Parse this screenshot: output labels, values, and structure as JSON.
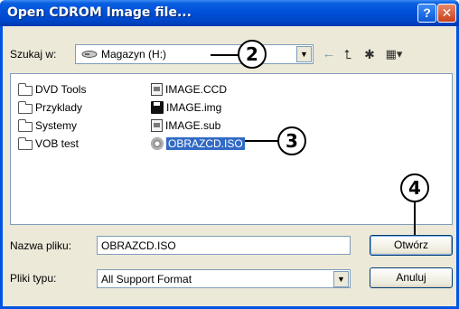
{
  "window": {
    "title": "Open CDROM Image file...",
    "help_label": "?",
    "close_label": "✕"
  },
  "toolbar": {
    "look_in_label": "Szukaj w:",
    "look_in_value": "Magazyn (H:)",
    "dropdown_glyph": "▼",
    "back_glyph": "←",
    "up_glyph": "⮤",
    "new_folder_glyph": "✱",
    "views_glyph": "▦▾",
    "icons": [
      "drive-icon",
      "back-icon",
      "up-folder-icon",
      "new-folder-icon",
      "views-icon"
    ]
  },
  "file_list": {
    "folders": [
      {
        "name": "DVD Tools",
        "icon": "folder-icon"
      },
      {
        "name": "Przyklady",
        "icon": "folder-icon"
      },
      {
        "name": "Systemy",
        "icon": "folder-icon"
      },
      {
        "name": "VOB test",
        "icon": "folder-icon"
      }
    ],
    "files": [
      {
        "name": "IMAGE.CCD",
        "icon": "file-icon"
      },
      {
        "name": "IMAGE.img",
        "icon": "floppy-icon"
      },
      {
        "name": "IMAGE.sub",
        "icon": "file-icon"
      },
      {
        "name": "OBRAZCD.ISO",
        "icon": "cd-icon",
        "selected": true
      }
    ]
  },
  "form": {
    "filename_label": "Nazwa pliku:",
    "filename_value": "OBRAZCD.ISO",
    "filetype_label": "Pliki typu:",
    "filetype_value": "All Support Format",
    "open_label": "Otwórz",
    "cancel_label": "Anuluj"
  },
  "callouts": {
    "c2": "2",
    "c3": "3",
    "c4": "4"
  },
  "colors": {
    "titlebar": "#0050d8",
    "selection": "#316ac5",
    "dialog_bg": "#ece9d8"
  }
}
